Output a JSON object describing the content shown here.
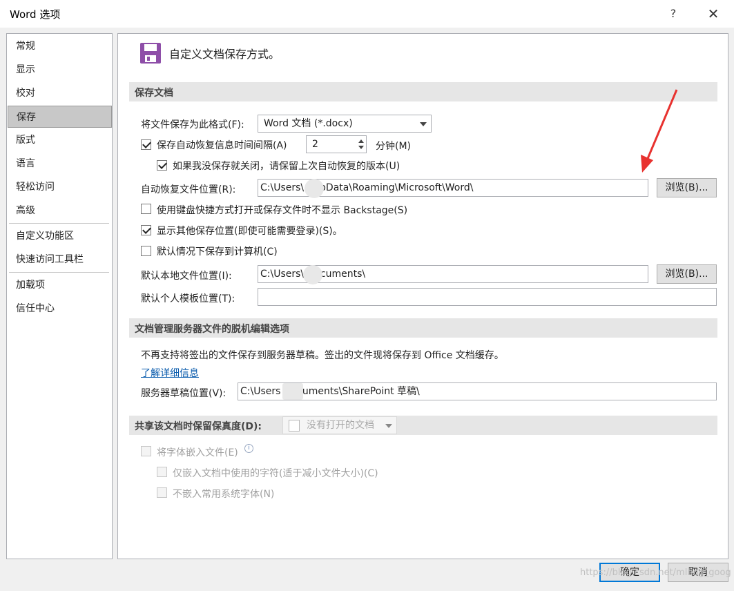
{
  "window": {
    "title": "Word 选项",
    "help": "?",
    "close": "✕"
  },
  "sidebar": {
    "items": [
      {
        "label": "常规"
      },
      {
        "label": "显示"
      },
      {
        "label": "校对"
      },
      {
        "label": "保存"
      },
      {
        "label": "版式"
      },
      {
        "label": "语言"
      },
      {
        "label": "轻松访问"
      },
      {
        "label": "高级"
      },
      {
        "label": "自定义功能区"
      },
      {
        "label": "快速访问工具栏"
      },
      {
        "label": "加载项"
      },
      {
        "label": "信任中心"
      }
    ],
    "selected": "保存"
  },
  "header": {
    "text": "自定义文档保存方式。",
    "icon": "floppy-disk-icon",
    "icon_color": "#8e4ea8"
  },
  "save_docs": {
    "section_title": "保存文档",
    "format_label": "将文件保存为此格式(F):",
    "format_value": "Word 文档 (*.docx)",
    "autorecover_label": "保存自动恢复信息时间间隔(A)",
    "autorecover_checked": true,
    "autorecover_minutes": "2",
    "minutes_label": "分钟(M)",
    "keep_last_label": "如果我没保存就关闭，请保留上次自动恢复的版本(U)",
    "keep_last_checked": true,
    "autorecover_location_label": "自动恢复文件位置(R):",
    "autorecover_location_value": "C:\\Users\\     AppData\\Roaming\\Microsoft\\Word\\",
    "browse_label_1": "浏览(B)...",
    "no_backstage_label": "使用键盘快捷方式打开或保存文件时不显示 Backstage(S)",
    "no_backstage_checked": false,
    "show_additional_label": "显示其他保存位置(即使可能需要登录)(S)。",
    "show_additional_checked": true,
    "save_to_computer_label": "默认情况下保存到计算机(C)",
    "save_to_computer_checked": false,
    "default_local_label": "默认本地文件位置(I):",
    "default_local_value": "C:\\Users\\     Documents\\",
    "browse_label_2": "浏览(B)...",
    "default_template_label": "默认个人模板位置(T):",
    "default_template_value": ""
  },
  "offline_editing": {
    "section_title": "文档管理服务器文件的脱机编辑选项",
    "notice": "不再支持将签出的文件保存到服务器草稿。签出的文件现将保存到 Office 文档缓存。",
    "learn_more": "了解详细信息",
    "drafts_label": "服务器草稿位置(V):",
    "drafts_value": "C:\\Users      Documents\\SharePoint 草稿\\"
  },
  "fidelity": {
    "section_title": "共享该文档时保留保真度(D):",
    "document_dropdown": "没有打开的文档",
    "embed_fonts_label": "将字体嵌入文件(E)",
    "embed_used_chars_label": "仅嵌入文档中使用的字符(适于减小文件大小)(C)",
    "no_common_fonts_label": "不嵌入常用系统字体(N)"
  },
  "footer": {
    "ok": "确定",
    "cancel": "取消"
  },
  "annotation": {
    "arrow_color": "#e8322f"
  },
  "watermark": "https://blog.csdn.net/mlbog_goog"
}
